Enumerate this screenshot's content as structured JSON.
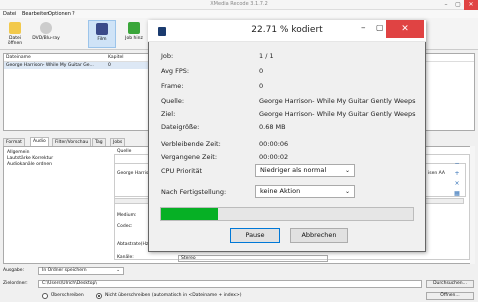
{
  "main_window": {
    "title": "XMedia Recode 3.1.7.2",
    "controls": [
      "–",
      "▢",
      "✕"
    ]
  },
  "menu": [
    "Datei",
    "Bearbeiten",
    "Optionen",
    "?"
  ],
  "toolbar": {
    "buttons": [
      {
        "label": "Datei öffnen",
        "icon": "folder-icon"
      },
      {
        "label": "DVD/Blu-ray",
        "icon": "disc-icon"
      },
      {
        "label": "Film",
        "icon": "film-icon"
      },
      {
        "label": "Job hinz",
        "icon": "add-icon"
      }
    ]
  },
  "file_list": {
    "columns": [
      "Dateiname",
      "Kapitel"
    ],
    "rows": [
      {
        "name": "George Harrison- While My Guitar Ge...",
        "kapitel": "0"
      }
    ]
  },
  "tabs": [
    "Format",
    "Audio",
    "Filter/Vorschau",
    "Tag",
    "Jobs"
  ],
  "active_tab": "Audio",
  "audio_panel": {
    "left_items": [
      "Allgemein",
      "Lautstärke Korrektur",
      "Audiokanäle ordnen"
    ],
    "quelle_label": "Quelle",
    "source_row": "George Harrison",
    "right_text": "isen AA",
    "fields": {
      "medium": "Medium:",
      "codec": "Codec:",
      "abtastrate": "Abtastrate(Hz):",
      "kanaele": "Kanäle:",
      "kanaele_value": "Stereo"
    }
  },
  "bottom": {
    "ausgabe_label": "Ausgabe:",
    "ausgabe_value": "In Ordner speichern",
    "zielordner_label": "Zielordner:",
    "zielordner_value": "C:\\Users\\Ulrich\\Desktop\\",
    "durchsuchen": "Durchsuchen...",
    "oeffnen": "Öffnen...",
    "radio_overwrite": "Überschreiben",
    "radio_nocopy": "Nicht überschreiben (automatisch in <Dateiname + index>)",
    "radio_selected": "nocopy"
  },
  "dialog": {
    "title": "22.71 % kodiert",
    "job_label": "Job:",
    "job_value": "1 / 1",
    "fps_label": "Avg FPS:",
    "fps_value": "0",
    "frame_label": "Frame:",
    "frame_value": "0",
    "quelle_label": "Quelle:",
    "quelle_value": "George Harrison- While My Guitar Gently Weeps",
    "ziel_label": "Ziel:",
    "ziel_value": "George Harrison- While My Guitar Gently Weeps",
    "groesse_label": "Dateigröße:",
    "groesse_value": "0.68 MB",
    "verbleibend_label": "Verbleibende Zeit:",
    "verbleibend_value": "00:00:06",
    "vergangen_label": "Vergangene Zeit:",
    "vergangen_value": "00:00:02",
    "prioritaet_label": "CPU Priorität",
    "prioritaet_value": "Niedriger als normal",
    "nach_label": "Nach Fertigstellung:",
    "nach_value": "keine Aktion",
    "progress": 0.2271,
    "pause_label": "Pause",
    "abbrechen_label": "Abbrechen",
    "progress_color": "#06b025",
    "close_color": "#e04343"
  }
}
